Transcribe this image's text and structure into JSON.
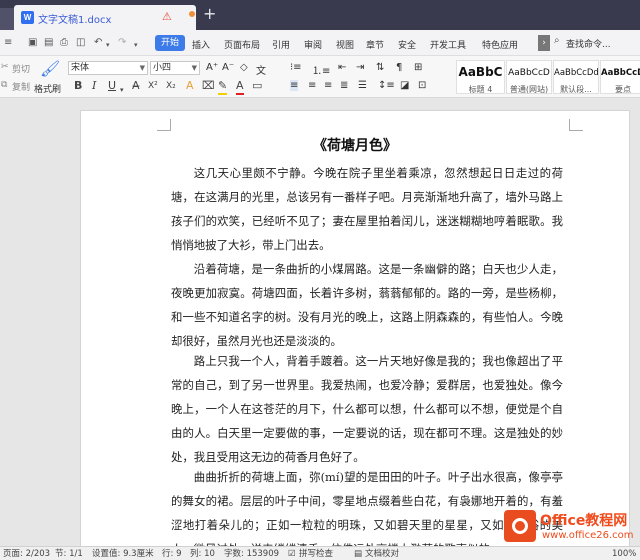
{
  "tab": {
    "filename": "文字文稿1.docx",
    "new_tab": "+"
  },
  "menubar": {
    "start": "开始",
    "items": [
      "插入",
      "页面布局",
      "引用",
      "审阅",
      "视图",
      "章节",
      "安全",
      "开发工具",
      "特色应用"
    ],
    "search": "查找命令..."
  },
  "toolbar": {
    "cut": "剪切",
    "copy": "复制",
    "format_painter": "格式刷",
    "font_name": "宋体",
    "font_size": "小四",
    "styles": [
      {
        "sample": "AaBbC",
        "name": "标题 4"
      },
      {
        "sample": "AaBbCcD",
        "name": "普通(网站)"
      },
      {
        "sample": "AaBbCcDd",
        "name": "默认段..."
      },
      {
        "sample": "AaBbCcDd",
        "name": "要点"
      }
    ]
  },
  "document": {
    "title": "《荷塘月色》",
    "paragraphs": [
      "这几天心里颇不宁静。今晚在院子里坐着乘凉，忽然想起日日走过的荷塘，在这满月的光里，总该另有一番样子吧。月亮渐渐地升高了，墙外马路上孩子们的欢笑，已经听不见了；妻在屋里拍着闰儿，迷迷糊糊地哼着眠歌。我悄悄地披了大衫，带上门出去。",
      "沿着荷塘，是一条曲折的小煤屑路。这是一条幽僻的路；白天也少人走，夜晚更加寂寞。荷塘四面，长着许多树，蓊蓊郁郁的。路的一旁，是些杨柳，和一些不知道名字的树。没有月光的晚上，这路上阴森森的，有些怕人。今晚却很好，虽然月光也还是淡淡的。",
      "路上只我一个人，背着手踱着。这一片天地好像是我的；我也像超出了平常的自己，到了另一世界里。我爱热闹，也爱冷静；爱群居，也爱独处。像今晚上，一个人在这苍茫的月下，什么都可以想，什么都可以不想，便觉是个自由的人。白天里一定要做的事，一定要说的话，现在都可不理。这是独处的妙处，我且受用这无边的荷香月色好了。",
      "曲曲折折的荷塘上面，弥(mí)望的是田田的叶子。叶子出水很高，像亭亭的舞女的裙。层层的叶子中间，零星地点缀着些白花，有袅娜地开着的，有羞涩地打着朵儿的；正如一粒粒的明珠，又如碧天里的星星，又如刚出浴的美人。微风过处，送来缕缕清香，仿佛远处高楼上渺茫的歌声似的。"
    ]
  },
  "watermark": {
    "brand": "Office教程网",
    "url": "www.office26.com"
  },
  "statusbar": {
    "page": "页面: 2/203",
    "section": "节: 1/1",
    "setting": "设置值: 9.3厘米",
    "row": "行: 9",
    "col": "列: 10",
    "words": "字数: 153909",
    "spell": "拼写检查",
    "proof": "文档校对",
    "zoom": "100%"
  }
}
